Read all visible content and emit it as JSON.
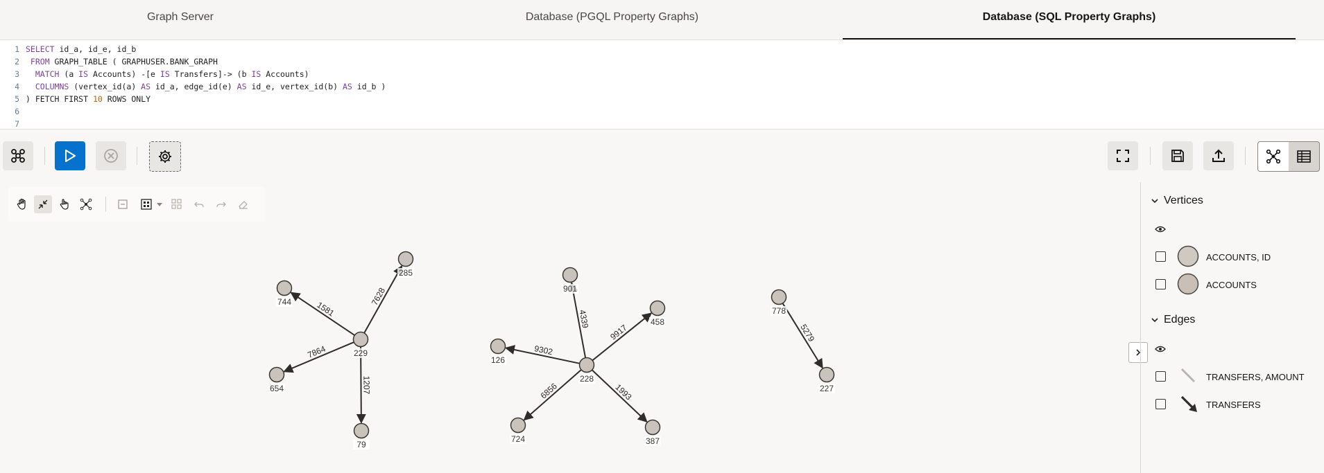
{
  "tabs": [
    {
      "label": "Graph Server"
    },
    {
      "label": "Database (PGQL Property Graphs)"
    },
    {
      "label": "Database (SQL Property Graphs)"
    }
  ],
  "editor": {
    "lines": [
      {
        "n": "1",
        "a": "SELECT",
        "b": " id_a, id_e, id_b"
      },
      {
        "n": "2",
        "a": " FROM",
        "b": " GRAPH_TABLE ( GRAPHUSER.BANK_GRAPH"
      },
      {
        "n": "3",
        "a": "  MATCH",
        "b": " (a ",
        "c": "IS",
        "d": " Accounts) -[e ",
        "e": "IS",
        "f": " Transfers]-> (b ",
        "g": "IS",
        "h": " Accounts)"
      },
      {
        "n": "4",
        "a": "  COLUMNS",
        "b": " (vertex_id(a) ",
        "c": "AS",
        "d": " id_a, edge_id(e) ",
        "e": "AS",
        "f": " id_e, vertex_id(b) ",
        "g": "AS",
        "h": " id_b )"
      },
      {
        "n": "5",
        "a": ") FETCH FIRST ",
        "b": "10",
        "c": " ROWS ONLY"
      },
      {
        "n": "6"
      },
      {
        "n": "7"
      }
    ]
  },
  "graph": {
    "nodes": [
      {
        "id": "285"
      },
      {
        "id": "744"
      },
      {
        "id": "229"
      },
      {
        "id": "654"
      },
      {
        "id": "79"
      },
      {
        "id": "901"
      },
      {
        "id": "458"
      },
      {
        "id": "126"
      },
      {
        "id": "228"
      },
      {
        "id": "724"
      },
      {
        "id": "387"
      },
      {
        "id": "778"
      },
      {
        "id": "227"
      }
    ],
    "edges": [
      {
        "from": "229",
        "to": "744",
        "label": "1581"
      },
      {
        "from": "229",
        "to": "285",
        "label": "7628"
      },
      {
        "from": "229",
        "to": "654",
        "label": "7864"
      },
      {
        "from": "229",
        "to": "79",
        "label": "1207"
      },
      {
        "from": "228",
        "to": "901",
        "label": "4339"
      },
      {
        "from": "228",
        "to": "458",
        "label": "9917"
      },
      {
        "from": "228",
        "to": "126",
        "label": "9302"
      },
      {
        "from": "228",
        "to": "724",
        "label": "6856"
      },
      {
        "from": "228",
        "to": "387",
        "label": "1993"
      },
      {
        "from": "778",
        "to": "227",
        "label": "5279"
      }
    ]
  },
  "legend": {
    "vertices_title": "Vertices",
    "vertex_items": [
      {
        "label": "ACCOUNTS, ID"
      },
      {
        "label": "ACCOUNTS"
      }
    ],
    "edges_title": "Edges",
    "edge_items": [
      {
        "label": "TRANSFERS, AMOUNT"
      },
      {
        "label": "TRANSFERS"
      }
    ]
  },
  "colors": {
    "accent": "#0572ce",
    "node_fill": "#c9c3bb",
    "node_stroke": "#3a3632"
  },
  "icons": [
    "graph-icon",
    "run-icon",
    "cancel-icon",
    "settings-icon",
    "fullscreen-icon",
    "save-icon",
    "upload-icon",
    "graph-view-icon",
    "table-view-icon"
  ]
}
